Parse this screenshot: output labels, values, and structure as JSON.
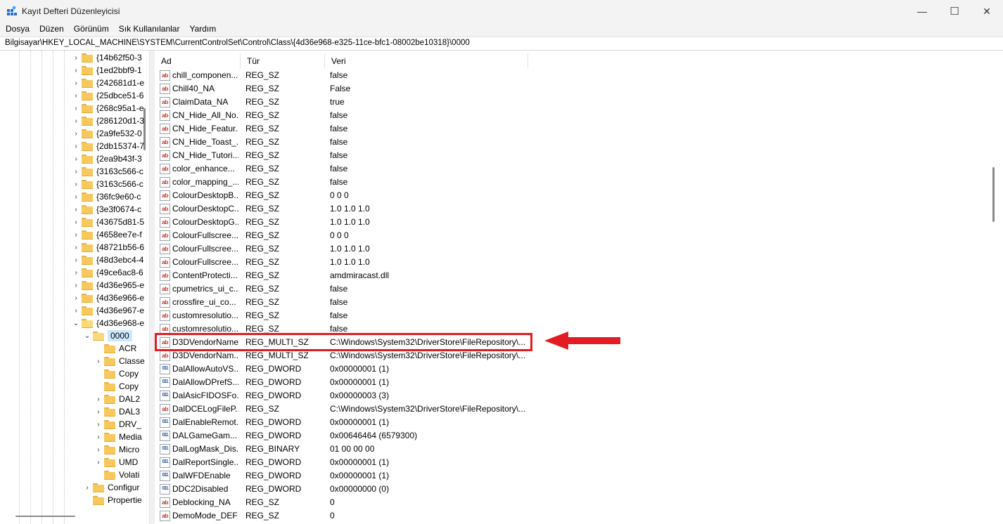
{
  "window": {
    "title": "Kayıt Defteri Düzenleyicisi",
    "minimize_glyph": "—",
    "maximize_glyph": "☐",
    "close_glyph": "✕"
  },
  "menu": [
    "Dosya",
    "Düzen",
    "Görünüm",
    "Sık Kullanılanlar",
    "Yardım"
  ],
  "address": "Bilgisayar\\HKEY_LOCAL_MACHINE\\SYSTEM\\CurrentControlSet\\Control\\Class\\{4d36e968-e325-11ce-bfc1-08002be10318}\\0000",
  "tree": {
    "class_keys": [
      "{14b62f50-3",
      "{1ed2bbf9-1",
      "{242681d1-e",
      "{25dbce51-6",
      "{268c95a1-e",
      "{286120d1-3",
      "{2a9fe532-0",
      "{2db15374-7",
      "{2ea9b43f-3",
      "{3163c566-c",
      "{3163c566-c",
      "{36fc9e60-c",
      "{3e3f0674-c",
      "{43675d81-5",
      "{4658ee7e-f",
      "{48721b56-6",
      "{48d3ebc4-4",
      "{49ce6ac8-6",
      "{4d36e965-e",
      "{4d36e966-e",
      "{4d36e967-e",
      "{4d36e968-e"
    ],
    "selected": "0000",
    "children": [
      "ACR",
      "Classe",
      "Copy",
      "Copy",
      "DAL2",
      "DAL3",
      "DRV_",
      "Media",
      "Micro",
      "UMD",
      "Volati"
    ],
    "siblings": [
      "Configur",
      "Propertie"
    ]
  },
  "columns": {
    "name": "Ad",
    "type": "Tür",
    "data": "Veri"
  },
  "values": [
    {
      "icon": "ab",
      "name": "chill_componen...",
      "type": "REG_SZ",
      "data": "false"
    },
    {
      "icon": "ab",
      "name": "Chill40_NA",
      "type": "REG_SZ",
      "data": "False"
    },
    {
      "icon": "ab",
      "name": "ClaimData_NA",
      "type": "REG_SZ",
      "data": "true"
    },
    {
      "icon": "ab",
      "name": "CN_Hide_All_No...",
      "type": "REG_SZ",
      "data": "false"
    },
    {
      "icon": "ab",
      "name": "CN_Hide_Featur...",
      "type": "REG_SZ",
      "data": "false"
    },
    {
      "icon": "ab",
      "name": "CN_Hide_Toast_...",
      "type": "REG_SZ",
      "data": "false"
    },
    {
      "icon": "ab",
      "name": "CN_Hide_Tutori...",
      "type": "REG_SZ",
      "data": "false"
    },
    {
      "icon": "ab",
      "name": "color_enhance...",
      "type": "REG_SZ",
      "data": "false"
    },
    {
      "icon": "ab",
      "name": "color_mapping_...",
      "type": "REG_SZ",
      "data": "false"
    },
    {
      "icon": "ab",
      "name": "ColourDesktopB...",
      "type": "REG_SZ",
      "data": "0 0 0"
    },
    {
      "icon": "ab",
      "name": "ColourDesktopC...",
      "type": "REG_SZ",
      "data": "1.0 1.0 1.0"
    },
    {
      "icon": "ab",
      "name": "ColourDesktopG...",
      "type": "REG_SZ",
      "data": "1.0 1.0 1.0"
    },
    {
      "icon": "ab",
      "name": "ColourFullscree...",
      "type": "REG_SZ",
      "data": "0 0 0"
    },
    {
      "icon": "ab",
      "name": "ColourFullscree...",
      "type": "REG_SZ",
      "data": "1.0 1.0 1.0"
    },
    {
      "icon": "ab",
      "name": "ColourFullscree...",
      "type": "REG_SZ",
      "data": "1.0 1.0 1.0"
    },
    {
      "icon": "ab",
      "name": "ContentProtecti...",
      "type": "REG_SZ",
      "data": "amdmiracast.dll"
    },
    {
      "icon": "ab",
      "name": "cpumetrics_ui_c...",
      "type": "REG_SZ",
      "data": "false"
    },
    {
      "icon": "ab",
      "name": "crossfire_ui_co...",
      "type": "REG_SZ",
      "data": "false"
    },
    {
      "icon": "ab",
      "name": "customresolutio...",
      "type": "REG_SZ",
      "data": "false"
    },
    {
      "icon": "ab",
      "name": "customresolutio...",
      "type": "REG_SZ",
      "data": "false"
    },
    {
      "icon": "ab",
      "name": "D3DVendorName",
      "type": "REG_MULTI_SZ",
      "data": "C:\\Windows\\System32\\DriverStore\\FileRepository\\..."
    },
    {
      "icon": "ab",
      "name": "D3DVendorNam...",
      "type": "REG_MULTI_SZ",
      "data": "C:\\Windows\\System32\\DriverStore\\FileRepository\\..."
    },
    {
      "icon": "bin",
      "name": "DalAllowAutoVS...",
      "type": "REG_DWORD",
      "data": "0x00000001 (1)"
    },
    {
      "icon": "bin",
      "name": "DalAllowDPrefS...",
      "type": "REG_DWORD",
      "data": "0x00000001 (1)"
    },
    {
      "icon": "bin",
      "name": "DalAsicFIDOSFo...",
      "type": "REG_DWORD",
      "data": "0x00000003 (3)"
    },
    {
      "icon": "ab",
      "name": "DalDCELogFileP...",
      "type": "REG_SZ",
      "data": "C:\\Windows\\System32\\DriverStore\\FileRepository\\..."
    },
    {
      "icon": "bin",
      "name": "DalEnableRemot...",
      "type": "REG_DWORD",
      "data": "0x00000001 (1)"
    },
    {
      "icon": "bin",
      "name": "DALGameGam...",
      "type": "REG_DWORD",
      "data": "0x00646464 (6579300)"
    },
    {
      "icon": "bin",
      "name": "DalLogMask_Dis...",
      "type": "REG_BINARY",
      "data": "01 00 00 00"
    },
    {
      "icon": "bin",
      "name": "DalReportSingle...",
      "type": "REG_DWORD",
      "data": "0x00000001 (1)"
    },
    {
      "icon": "bin",
      "name": "DalWFDEnable",
      "type": "REG_DWORD",
      "data": "0x00000001 (1)"
    },
    {
      "icon": "bin",
      "name": "DDC2Disabled",
      "type": "REG_DWORD",
      "data": "0x00000000 (0)"
    },
    {
      "icon": "ab",
      "name": "Deblocking_NA",
      "type": "REG_SZ",
      "data": "0"
    },
    {
      "icon": "ab",
      "name": "DemoMode_DEF",
      "type": "REG_SZ",
      "data": "0"
    }
  ],
  "icon_text": {
    "sz": "ab",
    "bin": "011"
  },
  "colors": {
    "highlight": "#e31b23",
    "selection": "#cce8ff"
  }
}
